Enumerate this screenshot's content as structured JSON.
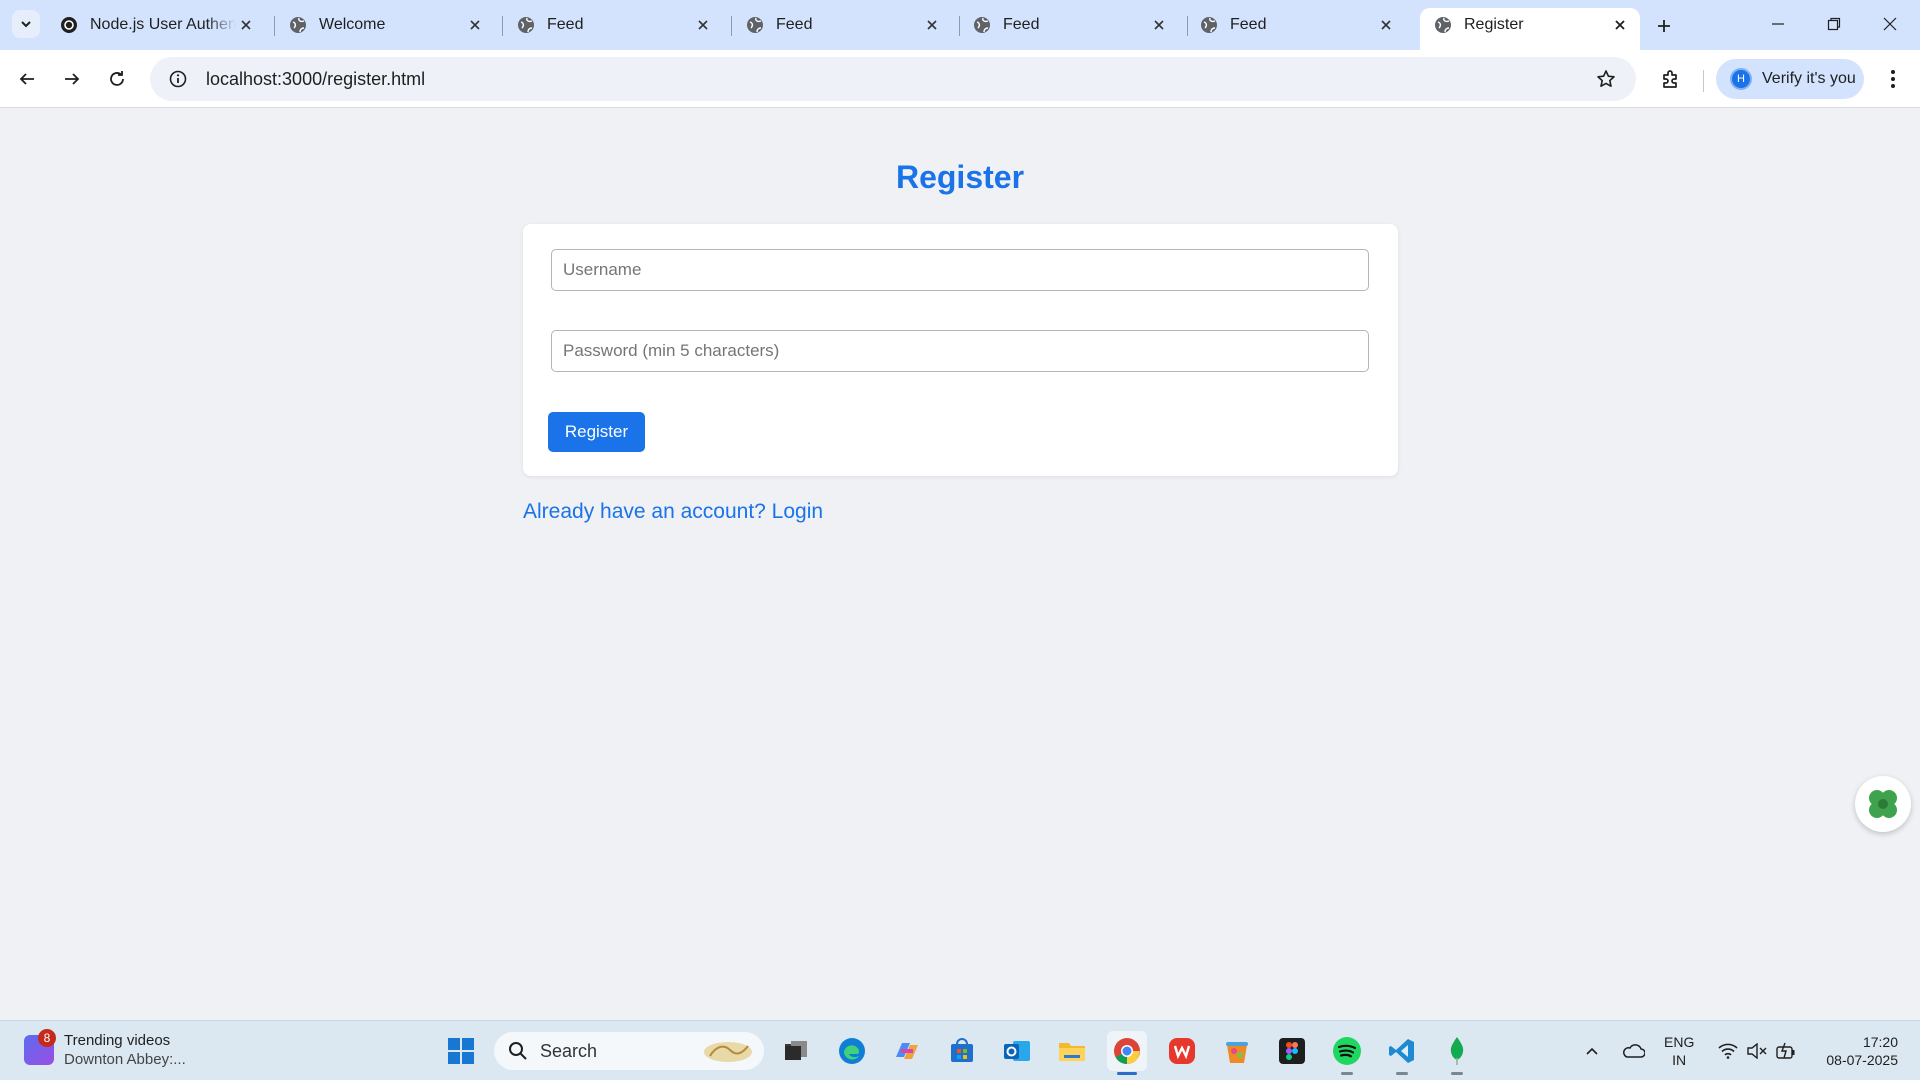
{
  "browser": {
    "tabs": [
      {
        "title": "Node.js User Authent",
        "favicon": "openai-icon"
      },
      {
        "title": "Welcome",
        "favicon": "globe-icon"
      },
      {
        "title": "Feed",
        "favicon": "globe-icon"
      },
      {
        "title": "Feed",
        "favicon": "globe-icon"
      },
      {
        "title": "Feed",
        "favicon": "globe-icon"
      },
      {
        "title": "Feed",
        "favicon": "globe-icon"
      },
      {
        "title": "Register",
        "favicon": "globe-icon",
        "active": true
      }
    ],
    "url": "localhost:3000/register.html",
    "profile": {
      "initial": "H",
      "label": "Verify it's you"
    }
  },
  "page": {
    "title": "Register",
    "username_placeholder": "Username",
    "password_placeholder": "Password (min 5 characters)",
    "submit_label": "Register",
    "login_link": "Already have an account? Login"
  },
  "taskbar": {
    "widget": {
      "badge": "8",
      "title": "Trending videos",
      "subtitle": "Downton Abbey:..."
    },
    "search_label": "Search",
    "apps": [
      "windows-start-icon",
      "task-view-icon",
      "edge-icon",
      "copilot-icon",
      "store-icon",
      "outlook-icon",
      "file-explorer-icon",
      "chrome-icon",
      "wps-icon",
      "paint-icon",
      "figma-icon",
      "spotify-icon",
      "vscode-icon",
      "mongodb-icon"
    ],
    "language": {
      "line1": "ENG",
      "line2": "IN"
    },
    "time": "17:20",
    "date": "08-07-2025"
  },
  "colors": {
    "accent": "#1a73e8",
    "page_bg": "#eff1f5",
    "tabstrip": "#d3e3fd"
  }
}
